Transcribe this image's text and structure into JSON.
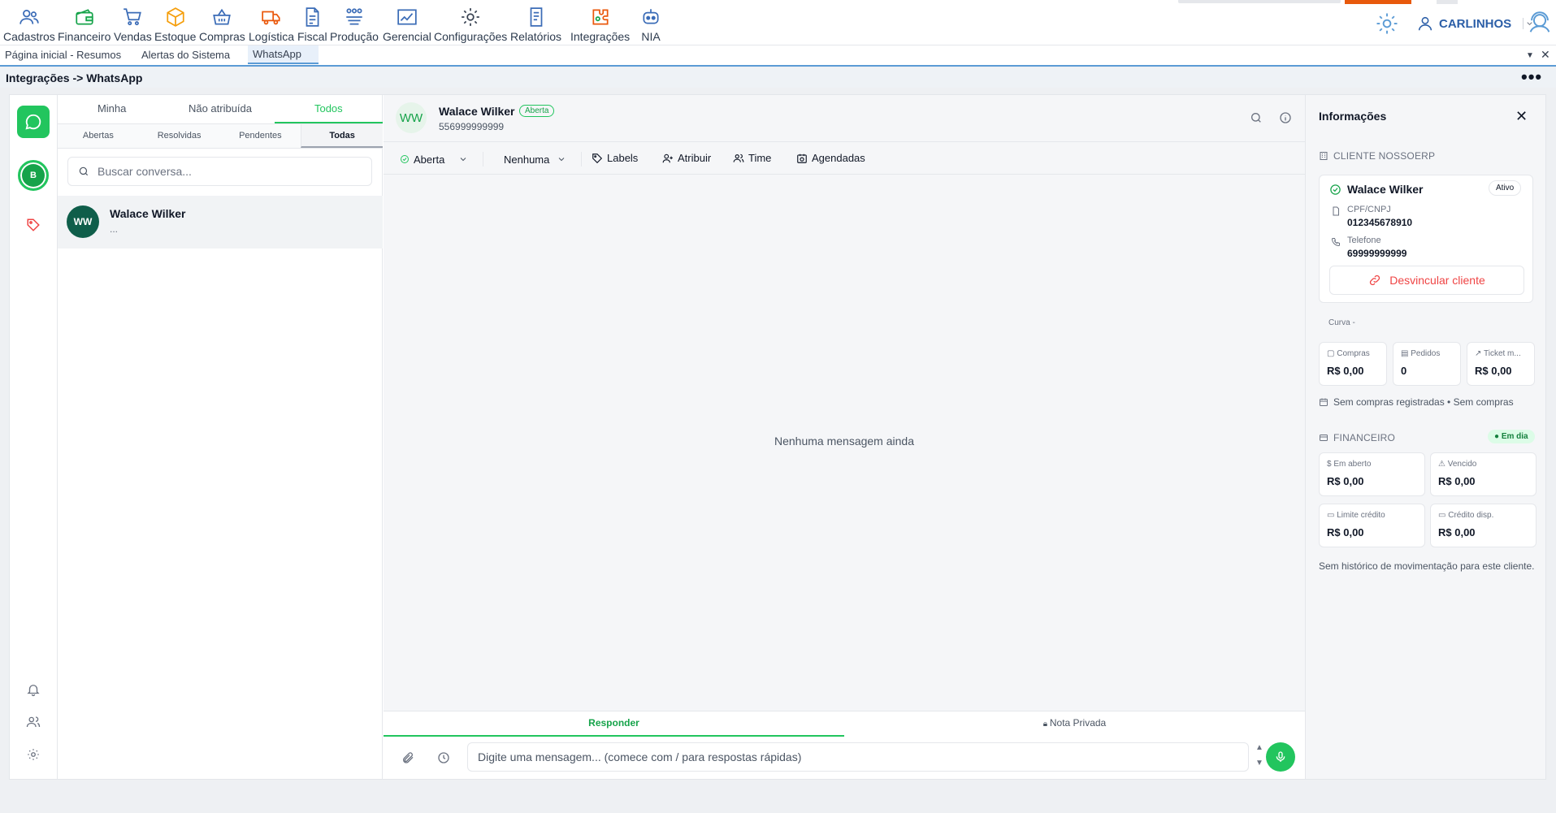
{
  "toolbar": {
    "items": [
      {
        "label": "Cadastros",
        "icon": "users-icon"
      },
      {
        "label": "Financeiro",
        "icon": "wallet-icon"
      },
      {
        "label": "Vendas",
        "icon": "cart-icon"
      },
      {
        "label": "Estoque",
        "icon": "box-icon"
      },
      {
        "label": "Compras",
        "icon": "basket-icon"
      },
      {
        "label": "Logística",
        "icon": "truck-icon"
      },
      {
        "label": "Fiscal",
        "icon": "document-icon"
      },
      {
        "label": "Produção",
        "icon": "factory-icon"
      },
      {
        "label": "Gerencial",
        "icon": "chart-icon"
      },
      {
        "label": "Configurações",
        "icon": "gear-icon"
      },
      {
        "label": "Relatórios",
        "icon": "report-icon"
      },
      {
        "label": "Integrações",
        "icon": "puzzle-icon"
      },
      {
        "label": "NIA",
        "icon": "robot-icon"
      }
    ],
    "user_name": "CARLINHOS"
  },
  "tabs": [
    {
      "label": "Página inicial - Resumos"
    },
    {
      "label": "Alertas do Sistema"
    },
    {
      "label": "WhatsApp"
    }
  ],
  "breadcrumb": "Integrações -> WhatsApp",
  "rail": {
    "avatar_initial": "B"
  },
  "conversations": {
    "filter_tabs": [
      "Minha",
      "Não atribuída",
      "Todos"
    ],
    "status_tabs": [
      "Abertas",
      "Resolvidas",
      "Pendentes",
      "Todas"
    ],
    "search_placeholder": "Buscar conversa...",
    "items": [
      {
        "initials": "WW",
        "name": "Walace Wilker",
        "preview": "..."
      }
    ]
  },
  "chat": {
    "initials": "WW",
    "name": "Walace Wilker",
    "status_badge": "Aberta",
    "phone": "556999999999",
    "actions": {
      "status": "Aberta",
      "priority": "Nenhuma",
      "labels": "Labels",
      "assign": "Atribuir",
      "team": "Time",
      "scheduled": "Agendadas"
    },
    "empty_text": "Nenhuma mensagem ainda",
    "reply_tab": "Responder",
    "private_tab": "Nota Privada",
    "input_placeholder": "Digite uma mensagem... (comece com / para respostas rápidas)"
  },
  "info": {
    "title": "Informações",
    "client_section": "CLIENTE NOSSOERP",
    "client_name": "Walace Wilker",
    "client_status": "Ativo",
    "doc_label": "CPF/CNPJ",
    "doc_value": "012345678910",
    "phone_label": "Telefone",
    "phone_value": "69999999999",
    "unlink_label": "Desvincular cliente",
    "curva": "Curva -",
    "stats": [
      {
        "label": "Compras",
        "value": "R$ 0,00"
      },
      {
        "label": "Pedidos",
        "value": "0"
      },
      {
        "label": "Ticket m...",
        "value": "R$ 0,00"
      }
    ],
    "purchases_note": "Sem compras registradas • Sem compras",
    "finance_section": "FINANCEIRO",
    "finance_status": "Em dia",
    "finance": [
      {
        "label": "Em aberto",
        "value": "R$ 0,00"
      },
      {
        "label": "Vencido",
        "value": "R$ 0,00"
      },
      {
        "label": "Limite crédito",
        "value": "R$ 0,00"
      },
      {
        "label": "Crédito disp.",
        "value": "R$ 0,00"
      }
    ],
    "history_note": "Sem histórico de movimentação para este cliente."
  },
  "colors": {
    "accent": "#22c55e",
    "danger": "#ef4444",
    "brand": "#2b5ea7"
  }
}
